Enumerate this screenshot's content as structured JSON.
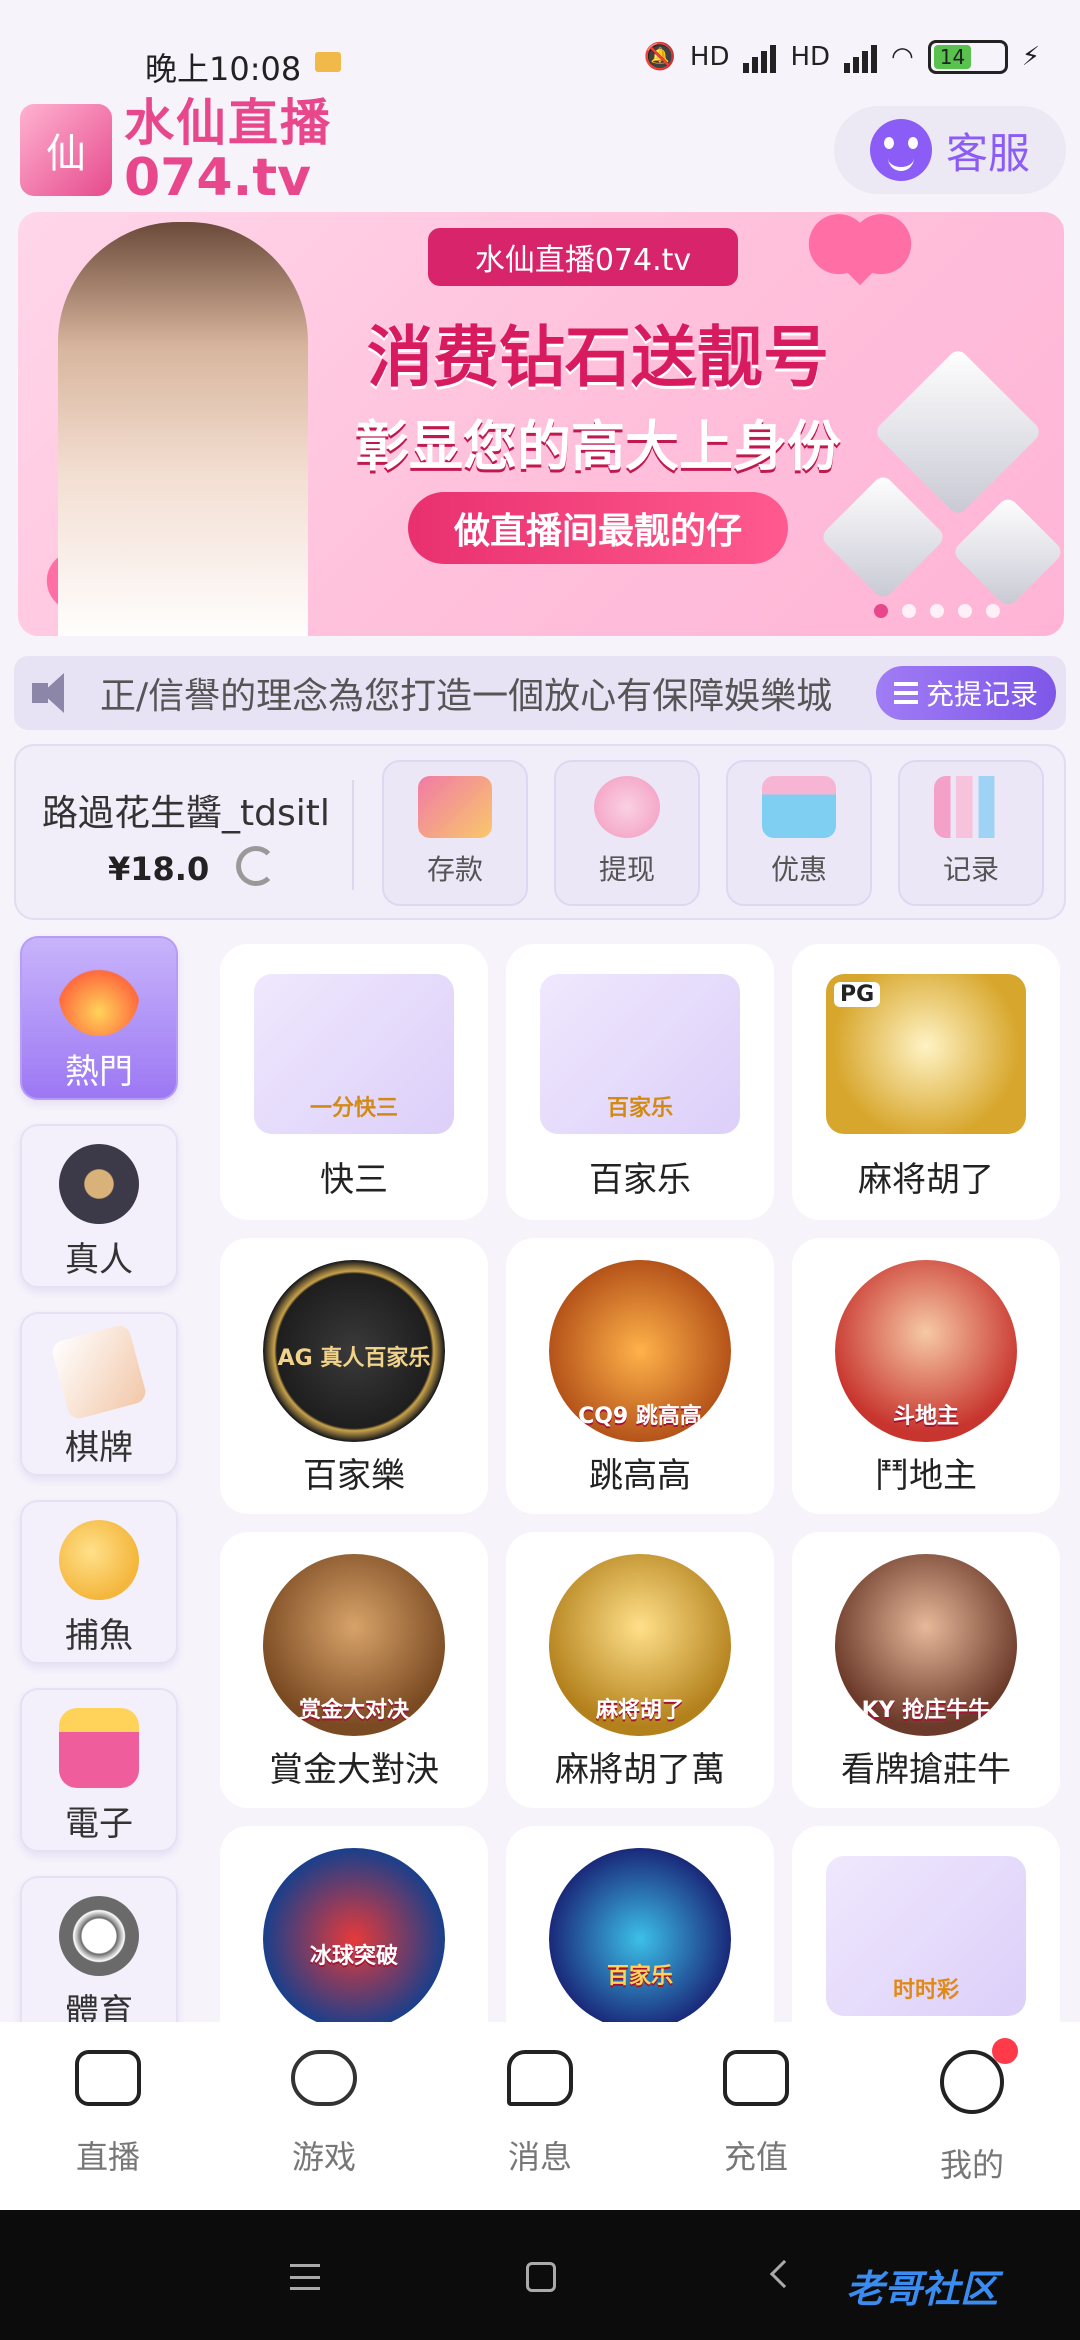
{
  "status_bar": {
    "time": "晚上10:08",
    "network_1": "HD",
    "network_2": "HD",
    "battery": "14"
  },
  "header": {
    "brand_cn": "水仙直播",
    "brand_en": "074.tv",
    "logo_text": "仙",
    "customer_service": "客服"
  },
  "banner": {
    "ribbon": "水仙直播074.tv",
    "title": "消费钻石送靓号",
    "subtitle": "彰显您的高大上身份",
    "pill": "做直播间最靓的仔"
  },
  "marquee": {
    "text": "正/信譽的理念為您打造一個放心有保障娛樂城",
    "record_button": "充提记录"
  },
  "account": {
    "username": "路過花生醬_tdsitl",
    "balance": "¥18.0",
    "actions": [
      {
        "label": "存款",
        "icon": "card-icon",
        "color": "#f07aa6"
      },
      {
        "label": "提现",
        "icon": "money-bag-icon",
        "color": "#f29ac0"
      },
      {
        "label": "优惠",
        "icon": "gift-icon",
        "color": "#7fcff3"
      },
      {
        "label": "记录",
        "icon": "bar-chart-icon",
        "color": "#f5a0c8"
      }
    ]
  },
  "categories": [
    {
      "label": "熱門",
      "icon": "fire-icon",
      "color": "#ff6a3d"
    },
    {
      "label": "真人",
      "icon": "chip-icon",
      "color": "#3c3a48"
    },
    {
      "label": "棋牌",
      "icon": "cards-icon",
      "color": "#f2c7a8"
    },
    {
      "label": "捕魚",
      "icon": "fish-icon",
      "color": "#f4b63c"
    },
    {
      "label": "電子",
      "icon": "slot-icon",
      "color": "#ef5d9c"
    },
    {
      "label": "體育",
      "icon": "football-icon",
      "color": "#6a6a6a"
    }
  ],
  "games": [
    {
      "label": "快三",
      "art": "一分快三",
      "style": "box",
      "color": "#e6dcfb"
    },
    {
      "label": "百家乐",
      "art": "百家乐",
      "style": "box",
      "color": "#e6dcfb"
    },
    {
      "label": "麻将胡了",
      "art": "PG",
      "style": "box",
      "color": "#d7a62c"
    },
    {
      "label": "百家樂",
      "art": "AG 真人百家乐",
      "style": "round",
      "color": "#1e1e1e"
    },
    {
      "label": "跳高高",
      "art": "CQ9 跳高高",
      "style": "round",
      "color": "#b5541a"
    },
    {
      "label": "鬥地主",
      "art": "斗地主",
      "style": "round",
      "color": "#c8352e"
    },
    {
      "label": "賞金大對決",
      "art": "赏金大对决",
      "style": "round",
      "color": "#7a4a22"
    },
    {
      "label": "麻將胡了萬",
      "art": "麻将胡了",
      "style": "round",
      "color": "#b3811c"
    },
    {
      "label": "看牌搶莊牛",
      "art": "KY 抢庄牛牛",
      "style": "round",
      "color": "#6b3a2a"
    },
    {
      "label": "",
      "art": "冰球突破",
      "style": "round",
      "color": "#1b3f8a"
    },
    {
      "label": "",
      "art": "百家乐",
      "style": "round",
      "color": "#1a2a7a"
    },
    {
      "label": "",
      "art": "时时彩",
      "style": "box",
      "color": "#e6dcfb"
    }
  ],
  "tabbar": [
    {
      "label": "直播",
      "icon": "camera-icon"
    },
    {
      "label": "游戏",
      "icon": "gamepad-icon"
    },
    {
      "label": "消息",
      "icon": "chat-icon"
    },
    {
      "label": "充值",
      "icon": "wallet-icon"
    },
    {
      "label": "我的",
      "icon": "profile-icon"
    }
  ],
  "watermark": "老哥社区"
}
